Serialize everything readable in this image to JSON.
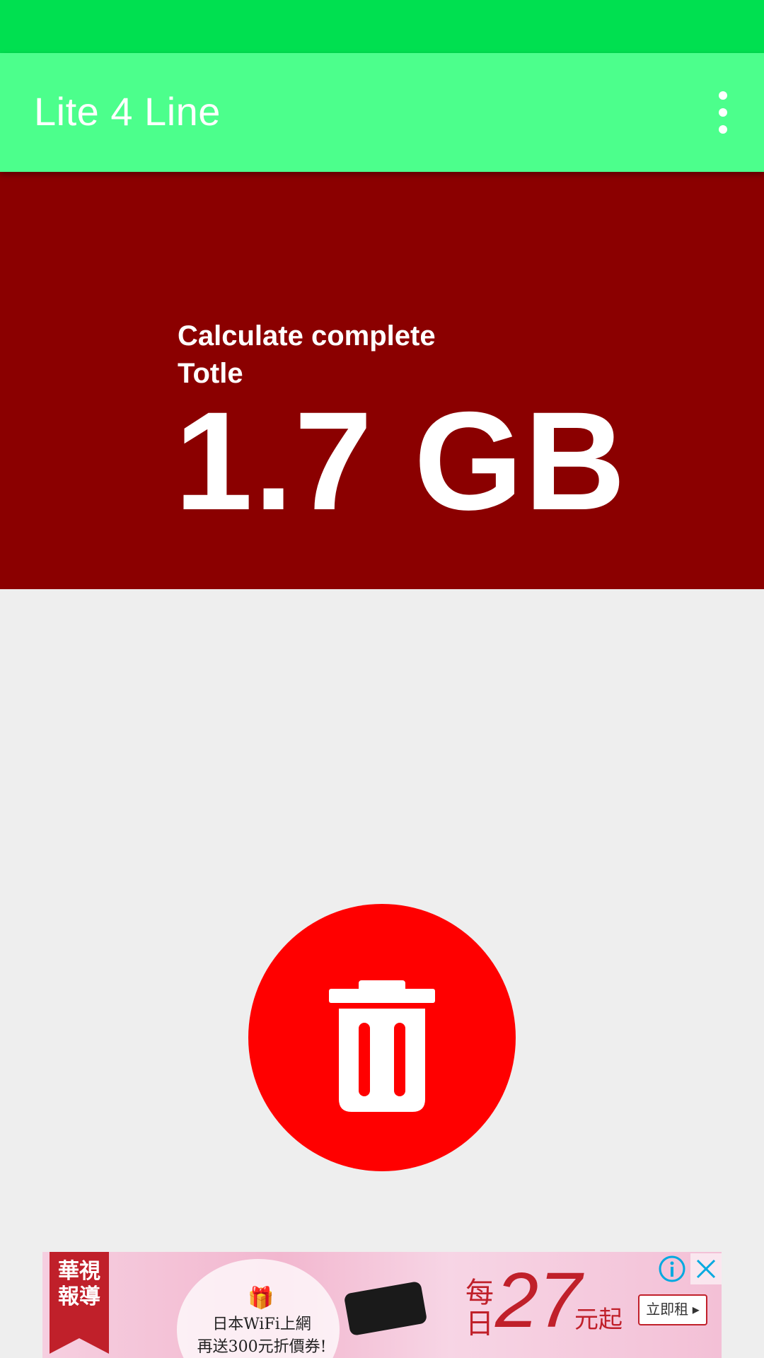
{
  "app_bar": {
    "title": "Lite 4 Line",
    "menu_icon": "more-vert-icon"
  },
  "summary": {
    "label_line1": "Calculate complete",
    "label_line2": "Totle",
    "total": "1.7 GB"
  },
  "actions": {
    "delete_icon": "trash-icon"
  },
  "ad": {
    "ribbon_line1": "華視",
    "ribbon_line2": "報導",
    "line1": "日本WiFi上網",
    "line2": "再送300元折價券!",
    "daily_line1": "每",
    "daily_line2": "日",
    "price": "27",
    "unit": "元起",
    "cta": "立即租 ▸",
    "info_icon": "info-icon",
    "close_icon": "close-icon"
  },
  "colors": {
    "status_bar": "#00e050",
    "app_bar": "#4cff8c",
    "summary_bg": "#8b0000",
    "delete_button": "#ff0000",
    "page_bg": "#eeeeee"
  }
}
